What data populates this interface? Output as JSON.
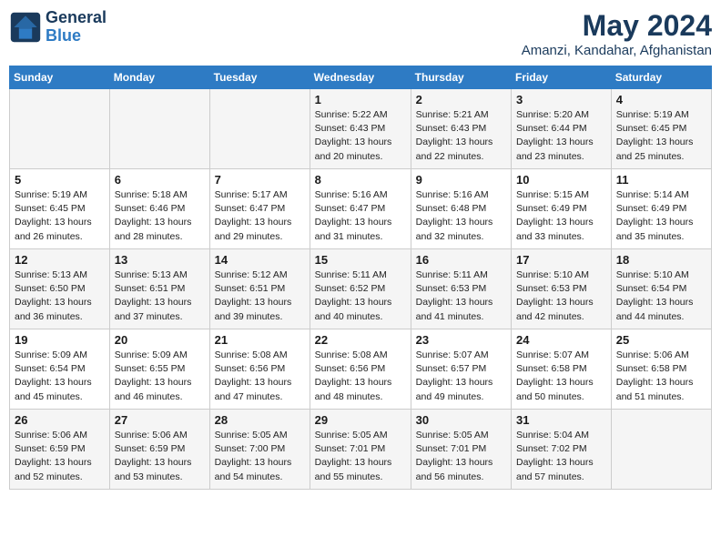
{
  "header": {
    "logo_line1": "General",
    "logo_line2": "Blue",
    "month_year": "May 2024",
    "location": "Amanzi, Kandahar, Afghanistan"
  },
  "days_of_week": [
    "Sunday",
    "Monday",
    "Tuesday",
    "Wednesday",
    "Thursday",
    "Friday",
    "Saturday"
  ],
  "weeks": [
    [
      {
        "day": "",
        "info": ""
      },
      {
        "day": "",
        "info": ""
      },
      {
        "day": "",
        "info": ""
      },
      {
        "day": "1",
        "info": "Sunrise: 5:22 AM\nSunset: 6:43 PM\nDaylight: 13 hours\nand 20 minutes."
      },
      {
        "day": "2",
        "info": "Sunrise: 5:21 AM\nSunset: 6:43 PM\nDaylight: 13 hours\nand 22 minutes."
      },
      {
        "day": "3",
        "info": "Sunrise: 5:20 AM\nSunset: 6:44 PM\nDaylight: 13 hours\nand 23 minutes."
      },
      {
        "day": "4",
        "info": "Sunrise: 5:19 AM\nSunset: 6:45 PM\nDaylight: 13 hours\nand 25 minutes."
      }
    ],
    [
      {
        "day": "5",
        "info": "Sunrise: 5:19 AM\nSunset: 6:45 PM\nDaylight: 13 hours\nand 26 minutes."
      },
      {
        "day": "6",
        "info": "Sunrise: 5:18 AM\nSunset: 6:46 PM\nDaylight: 13 hours\nand 28 minutes."
      },
      {
        "day": "7",
        "info": "Sunrise: 5:17 AM\nSunset: 6:47 PM\nDaylight: 13 hours\nand 29 minutes."
      },
      {
        "day": "8",
        "info": "Sunrise: 5:16 AM\nSunset: 6:47 PM\nDaylight: 13 hours\nand 31 minutes."
      },
      {
        "day": "9",
        "info": "Sunrise: 5:16 AM\nSunset: 6:48 PM\nDaylight: 13 hours\nand 32 minutes."
      },
      {
        "day": "10",
        "info": "Sunrise: 5:15 AM\nSunset: 6:49 PM\nDaylight: 13 hours\nand 33 minutes."
      },
      {
        "day": "11",
        "info": "Sunrise: 5:14 AM\nSunset: 6:49 PM\nDaylight: 13 hours\nand 35 minutes."
      }
    ],
    [
      {
        "day": "12",
        "info": "Sunrise: 5:13 AM\nSunset: 6:50 PM\nDaylight: 13 hours\nand 36 minutes."
      },
      {
        "day": "13",
        "info": "Sunrise: 5:13 AM\nSunset: 6:51 PM\nDaylight: 13 hours\nand 37 minutes."
      },
      {
        "day": "14",
        "info": "Sunrise: 5:12 AM\nSunset: 6:51 PM\nDaylight: 13 hours\nand 39 minutes."
      },
      {
        "day": "15",
        "info": "Sunrise: 5:11 AM\nSunset: 6:52 PM\nDaylight: 13 hours\nand 40 minutes."
      },
      {
        "day": "16",
        "info": "Sunrise: 5:11 AM\nSunset: 6:53 PM\nDaylight: 13 hours\nand 41 minutes."
      },
      {
        "day": "17",
        "info": "Sunrise: 5:10 AM\nSunset: 6:53 PM\nDaylight: 13 hours\nand 42 minutes."
      },
      {
        "day": "18",
        "info": "Sunrise: 5:10 AM\nSunset: 6:54 PM\nDaylight: 13 hours\nand 44 minutes."
      }
    ],
    [
      {
        "day": "19",
        "info": "Sunrise: 5:09 AM\nSunset: 6:54 PM\nDaylight: 13 hours\nand 45 minutes."
      },
      {
        "day": "20",
        "info": "Sunrise: 5:09 AM\nSunset: 6:55 PM\nDaylight: 13 hours\nand 46 minutes."
      },
      {
        "day": "21",
        "info": "Sunrise: 5:08 AM\nSunset: 6:56 PM\nDaylight: 13 hours\nand 47 minutes."
      },
      {
        "day": "22",
        "info": "Sunrise: 5:08 AM\nSunset: 6:56 PM\nDaylight: 13 hours\nand 48 minutes."
      },
      {
        "day": "23",
        "info": "Sunrise: 5:07 AM\nSunset: 6:57 PM\nDaylight: 13 hours\nand 49 minutes."
      },
      {
        "day": "24",
        "info": "Sunrise: 5:07 AM\nSunset: 6:58 PM\nDaylight: 13 hours\nand 50 minutes."
      },
      {
        "day": "25",
        "info": "Sunrise: 5:06 AM\nSunset: 6:58 PM\nDaylight: 13 hours\nand 51 minutes."
      }
    ],
    [
      {
        "day": "26",
        "info": "Sunrise: 5:06 AM\nSunset: 6:59 PM\nDaylight: 13 hours\nand 52 minutes."
      },
      {
        "day": "27",
        "info": "Sunrise: 5:06 AM\nSunset: 6:59 PM\nDaylight: 13 hours\nand 53 minutes."
      },
      {
        "day": "28",
        "info": "Sunrise: 5:05 AM\nSunset: 7:00 PM\nDaylight: 13 hours\nand 54 minutes."
      },
      {
        "day": "29",
        "info": "Sunrise: 5:05 AM\nSunset: 7:01 PM\nDaylight: 13 hours\nand 55 minutes."
      },
      {
        "day": "30",
        "info": "Sunrise: 5:05 AM\nSunset: 7:01 PM\nDaylight: 13 hours\nand 56 minutes."
      },
      {
        "day": "31",
        "info": "Sunrise: 5:04 AM\nSunset: 7:02 PM\nDaylight: 13 hours\nand 57 minutes."
      },
      {
        "day": "",
        "info": ""
      }
    ]
  ]
}
